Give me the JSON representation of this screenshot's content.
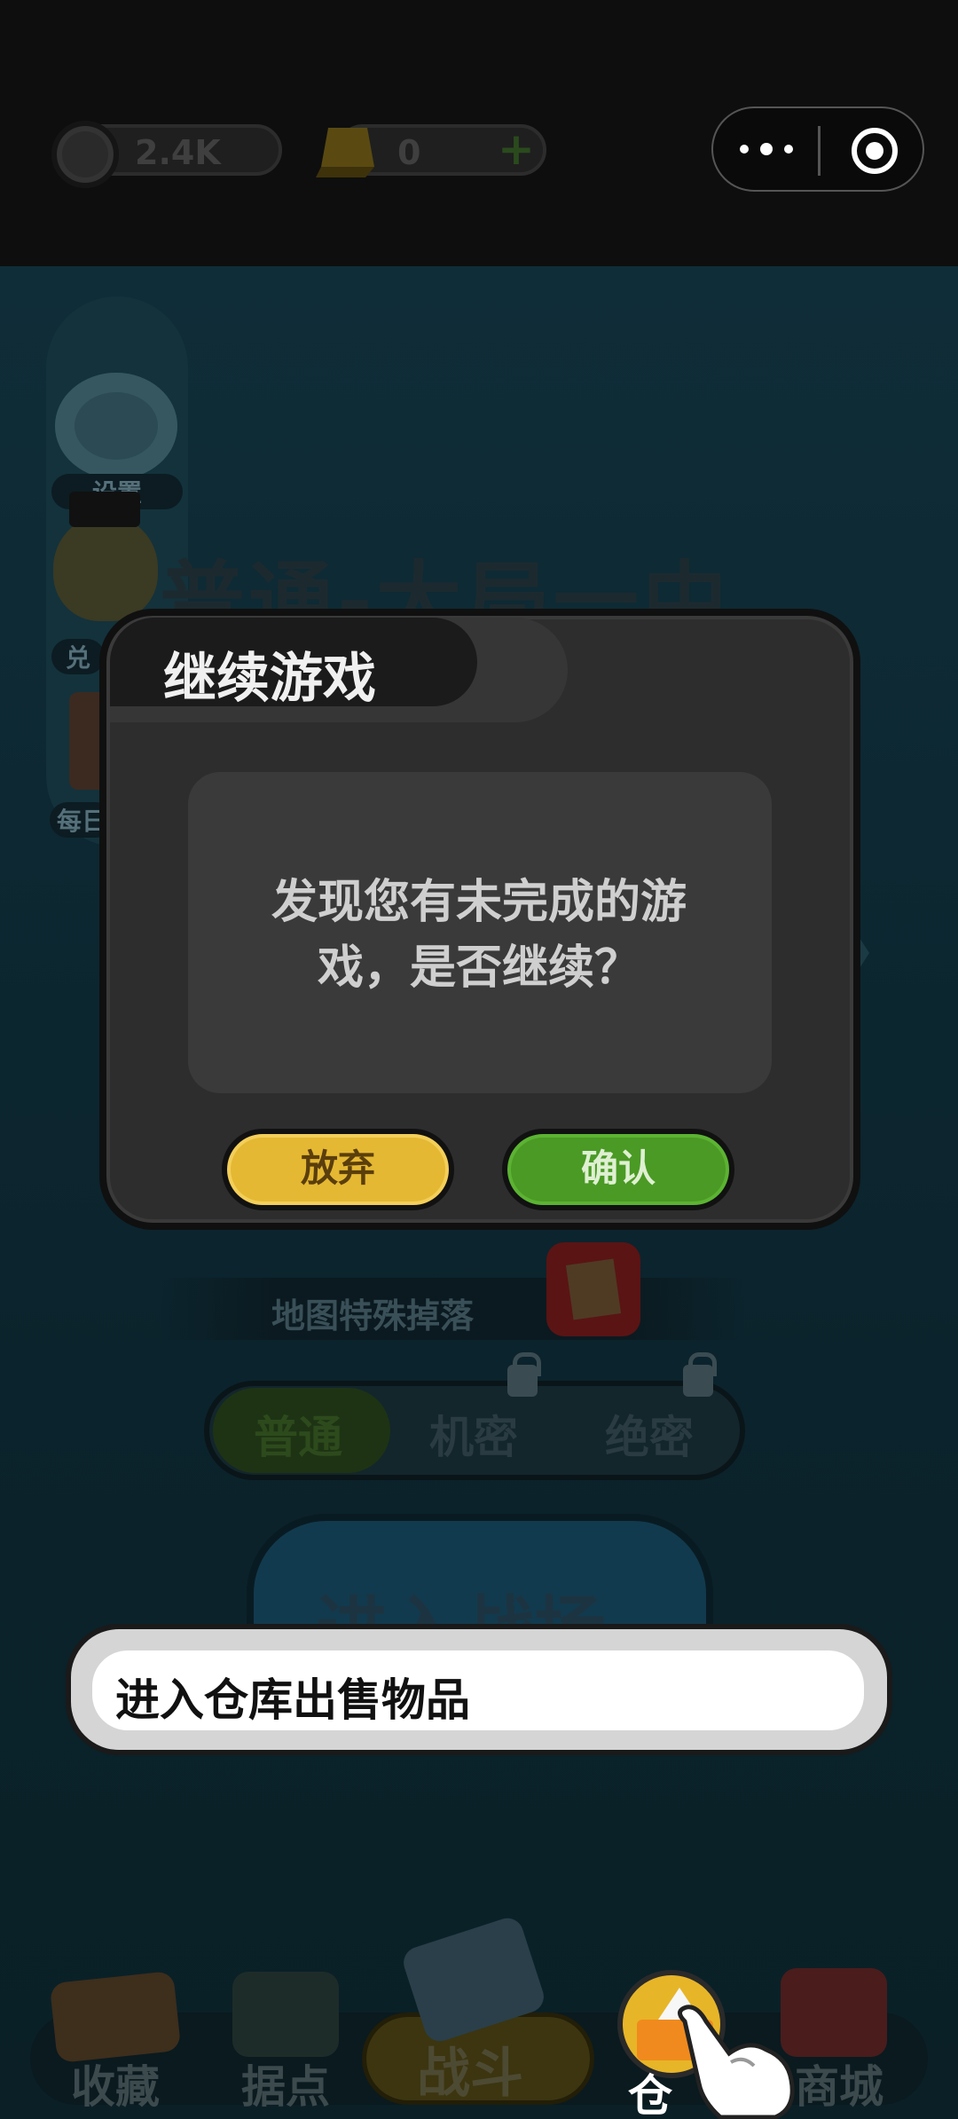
{
  "header": {
    "coins_value": "2.4K",
    "gold_value": "0",
    "plus_symbol": "+",
    "capsule_menu_icon": "more-dots-icon",
    "capsule_close_icon": "target-close-icon"
  },
  "sidebar": {
    "items": [
      {
        "label": "设置",
        "icon": "gear-icon"
      },
      {
        "label": "兑",
        "icon": "hamster-avatar-icon"
      },
      {
        "label": "每日",
        "icon": "daily-book-icon"
      }
    ]
  },
  "scene": {
    "title": "普通-大局一中",
    "special_drop_label": "地图特殊掉落",
    "modes": [
      "普通",
      "机密",
      "绝密"
    ],
    "enter_label": "进入战场"
  },
  "dialog": {
    "title": "继续游戏",
    "message": "发现您有未完成的游戏，是否继续？",
    "abandon_label": "放弃",
    "confirm_label": "确认"
  },
  "tutorial_tip": {
    "text": "进入仓库出售物品"
  },
  "bottom_nav": {
    "items": [
      {
        "label": "收藏",
        "icon": "book-icon"
      },
      {
        "label": "据点",
        "icon": "stronghold-icon"
      },
      {
        "label": "战斗",
        "icon": "battle-icon"
      },
      {
        "label": "仓库",
        "icon": "warehouse-icon"
      },
      {
        "label": "商城",
        "icon": "shop-icon"
      }
    ],
    "active_partial_label": "仓"
  },
  "colors": {
    "dialog_bg": "#2d2d2d",
    "abandon_yellow": "#e5b833",
    "confirm_green": "#4a9a25",
    "scene_teal": "#0f2d38"
  }
}
